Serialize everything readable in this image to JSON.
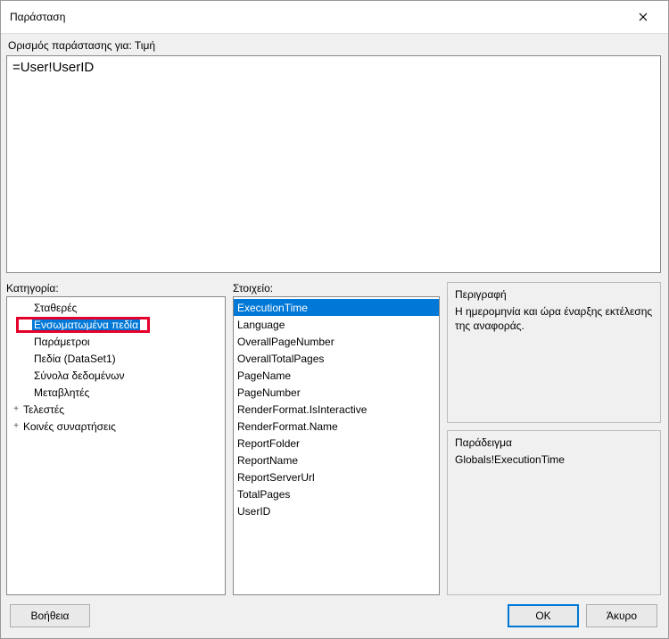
{
  "titlebar": {
    "title": "Παράσταση"
  },
  "field_for_label": "Ορισμός παράστασης για: Τιμή",
  "expression_value": "=User!UserID",
  "labels": {
    "category": "Κατηγορία:",
    "item": "Στοιχείο:",
    "description": "Περιγραφή",
    "example": "Παράδειγμα"
  },
  "categories": [
    {
      "label": "Σταθερές",
      "indent": 1,
      "expand": ""
    },
    {
      "label": "Ενσωματωμένα πεδία",
      "indent": 1,
      "expand": "",
      "selected": true,
      "redbox": true
    },
    {
      "label": "Παράμετροι",
      "indent": 1,
      "expand": ""
    },
    {
      "label": "Πεδία (DataSet1)",
      "indent": 1,
      "expand": ""
    },
    {
      "label": "Σύνολα δεδομένων",
      "indent": 1,
      "expand": ""
    },
    {
      "label": "Μεταβλητές",
      "indent": 1,
      "expand": ""
    },
    {
      "label": "Τελεστές",
      "indent": 0,
      "expand": "+"
    },
    {
      "label": "Κοινές συναρτήσεις",
      "indent": 0,
      "expand": "+"
    }
  ],
  "items": [
    {
      "label": "ExecutionTime",
      "selected": true
    },
    {
      "label": "Language"
    },
    {
      "label": "OverallPageNumber"
    },
    {
      "label": "OverallTotalPages"
    },
    {
      "label": "PageName"
    },
    {
      "label": "PageNumber"
    },
    {
      "label": "RenderFormat.IsInteractive"
    },
    {
      "label": "RenderFormat.Name"
    },
    {
      "label": "ReportFolder"
    },
    {
      "label": "ReportName"
    },
    {
      "label": "ReportServerUrl"
    },
    {
      "label": "TotalPages"
    },
    {
      "label": "UserID"
    }
  ],
  "description_text": "Η ημερομηνία και ώρα έναρξης εκτέλεσης της αναφοράς.",
  "example_text": "Globals!ExecutionTime",
  "buttons": {
    "help": "Βοήθεια",
    "ok": "OK",
    "cancel": "Άκυρο"
  }
}
